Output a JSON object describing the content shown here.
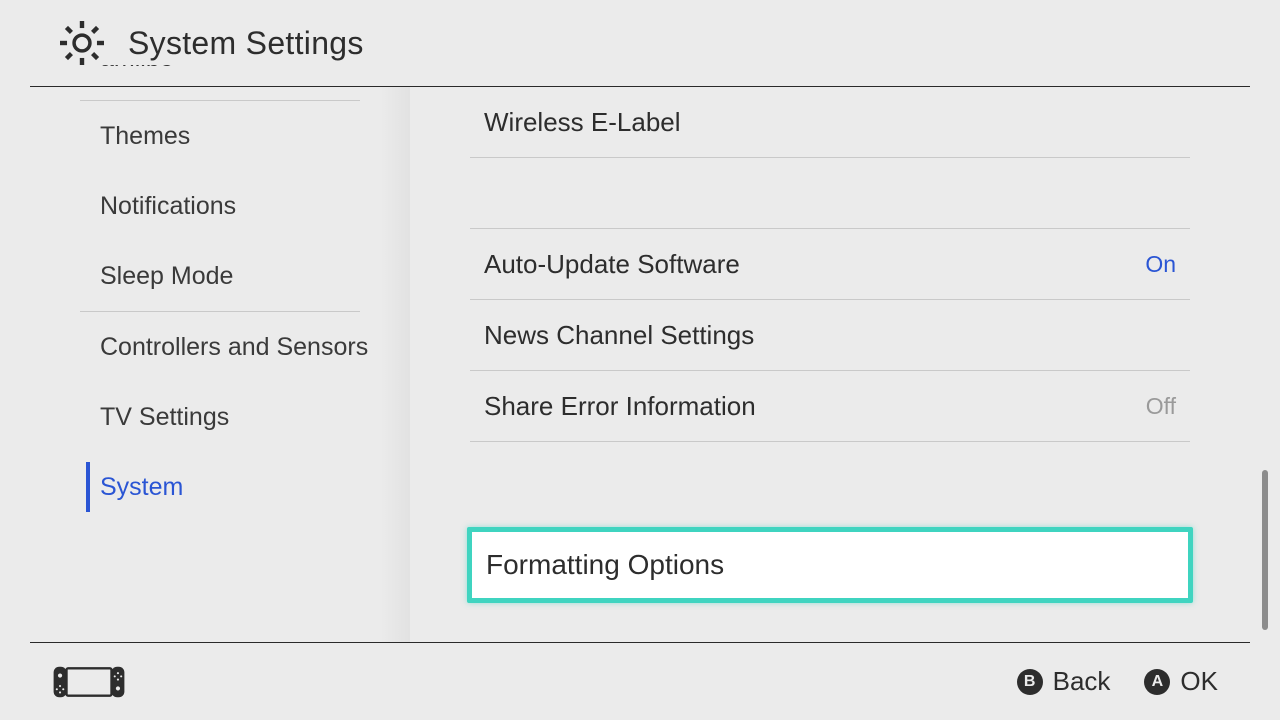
{
  "header": {
    "title": "System Settings"
  },
  "sidebar": {
    "items": [
      {
        "label": "amiibo"
      },
      {
        "label": "Themes"
      },
      {
        "label": "Notifications"
      },
      {
        "label": "Sleep Mode"
      },
      {
        "label": "Controllers and Sensors"
      },
      {
        "label": "TV Settings"
      },
      {
        "label": "System"
      }
    ],
    "activeLabel": "System"
  },
  "main": {
    "rows": [
      {
        "label": "Wireless E-Label",
        "value": ""
      },
      {
        "label": "",
        "value": ""
      },
      {
        "label": "Auto-Update Software",
        "value": "On",
        "value_kind": "on"
      },
      {
        "label": "News Channel Settings",
        "value": ""
      },
      {
        "label": "Share Error Information",
        "value": "Off",
        "value_kind": "off"
      }
    ],
    "selected": {
      "label": "Formatting Options"
    }
  },
  "footer": {
    "hints": [
      {
        "button": "B",
        "label": "Back"
      },
      {
        "button": "A",
        "label": "OK"
      }
    ]
  },
  "colors": {
    "accent_blue": "#2a55d4",
    "accent_teal": "#3fd4c0",
    "bg": "#ebebeb"
  }
}
